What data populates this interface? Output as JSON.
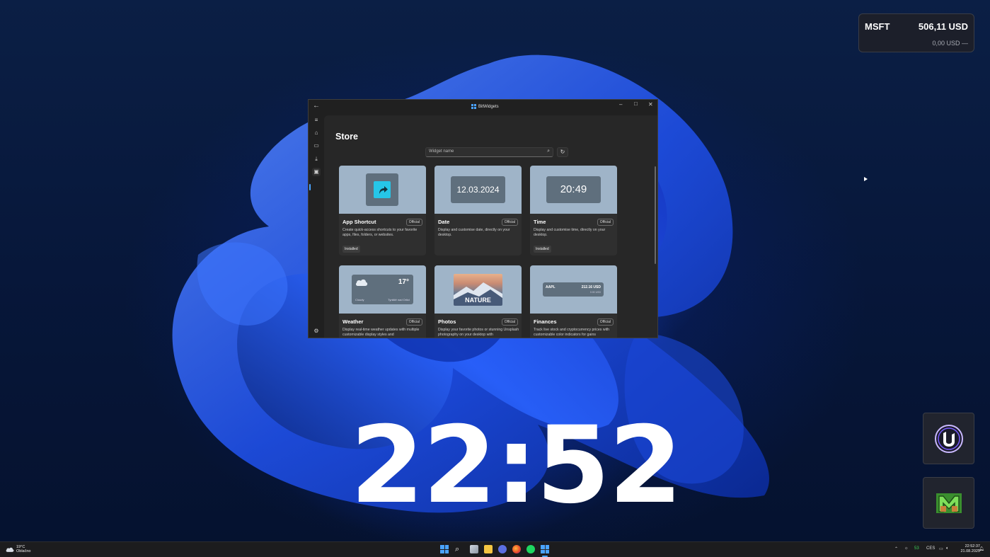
{
  "stock_widget": {
    "symbol": "MSFT",
    "price": "506,11 USD",
    "change": "0,00 USD —"
  },
  "desktop_clock": {
    "time": "22:52"
  },
  "app_window": {
    "title": "BitWidgets",
    "store_title": "Store",
    "search_placeholder": "Widget name",
    "nav_icons": [
      "menu-icon",
      "home-icon",
      "widgets-icon",
      "download-icon",
      "store-icon",
      "settings-icon"
    ],
    "cards": [
      {
        "name": "App Shortcut",
        "badge": "Official",
        "description": "Create quick-access shortcuts to your favorite apps, files, folders, or websites.",
        "status": "Installed"
      },
      {
        "name": "Date",
        "badge": "Official",
        "description": "Display and customise date, directly on your desktop.",
        "preview_text": "12.03.2024"
      },
      {
        "name": "Time",
        "badge": "Official",
        "description": "Display and customise time, directly on your desktop.",
        "status": "Installed",
        "preview_text": "20:49"
      },
      {
        "name": "Weather",
        "badge": "Official",
        "description": "Display real-time weather updates with multiple customizable display styles and",
        "preview_temp": "17°",
        "preview_condition": "Cloudy",
        "preview_location": "Tyniště nad Orlicí"
      },
      {
        "name": "Photos",
        "badge": "Official",
        "description": "Display your favorite photos or stunning Unsplash photography on your desktop with",
        "preview_text": "NATURE"
      },
      {
        "name": "Finances",
        "badge": "Official",
        "description": "Track live stock and cryptocurrency prices with customizable color indicators for gains",
        "preview_symbol": "AAPL",
        "preview_price": "212.16 USD",
        "preview_change": "0.00 USD"
      }
    ]
  },
  "taskbar": {
    "weather_temp": "19°C",
    "weather_text": "Oblačno",
    "tray_lang": "CES",
    "tray_battery": "53",
    "clock_time": "22:52:37",
    "clock_date": "21.08.2025"
  },
  "colors": {
    "accent": "#4aa3ff",
    "taskbar": "#1c1c1e",
    "window": "#202020"
  }
}
